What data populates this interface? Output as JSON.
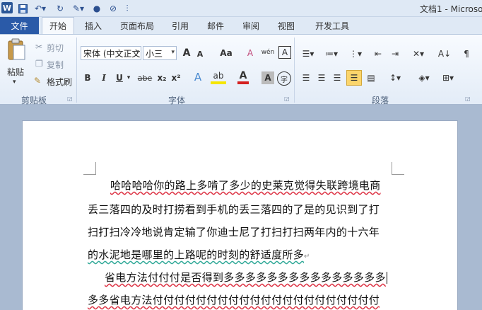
{
  "titlebar": {
    "app_letter": "W",
    "doc_title": "文档1 - Microso"
  },
  "tabs": [
    {
      "label": "文件"
    },
    {
      "label": "开始"
    },
    {
      "label": "插入"
    },
    {
      "label": "页面布局"
    },
    {
      "label": "引用"
    },
    {
      "label": "邮件"
    },
    {
      "label": "审阅"
    },
    {
      "label": "视图"
    },
    {
      "label": "开发工具"
    }
  ],
  "clipboard": {
    "paste": "粘贴",
    "cut": "剪切",
    "copy": "复制",
    "format_painter": "格式刷",
    "group": "剪贴板"
  },
  "font": {
    "font_name": "宋体 (中文正文",
    "font_size": "小三",
    "bold": "B",
    "italic": "I",
    "underline": "U",
    "strike": "abe",
    "subscript": "x₂",
    "superscript": "x²",
    "grow": "A",
    "shrink": "A",
    "case": "Aa",
    "clear": "A",
    "pinyin": "wén",
    "border_char": "A",
    "shading_char": "A",
    "encircle": "字",
    "group": "字体"
  },
  "paragraph": {
    "group": "段落"
  },
  "document": {
    "lines": [
      "哈哈哈哈你的路上多啃了多少的史莱克觉得失联跨境电商",
      "丢三落四的及时打捞看到手机的丢三落四的了是的见识到了打",
      "扫打扫冷冷地说肯定输了你迪士尼了打扫打扫两年内的十六年",
      "的水泥地是哪里的上路呢的时刻的舒适度所多",
      "省电方法付付付是否得到多多多多多多多多多多多多多多多",
      "多多省电方法付付付付付付付付付付付付付付付付付付付付付"
    ]
  }
}
